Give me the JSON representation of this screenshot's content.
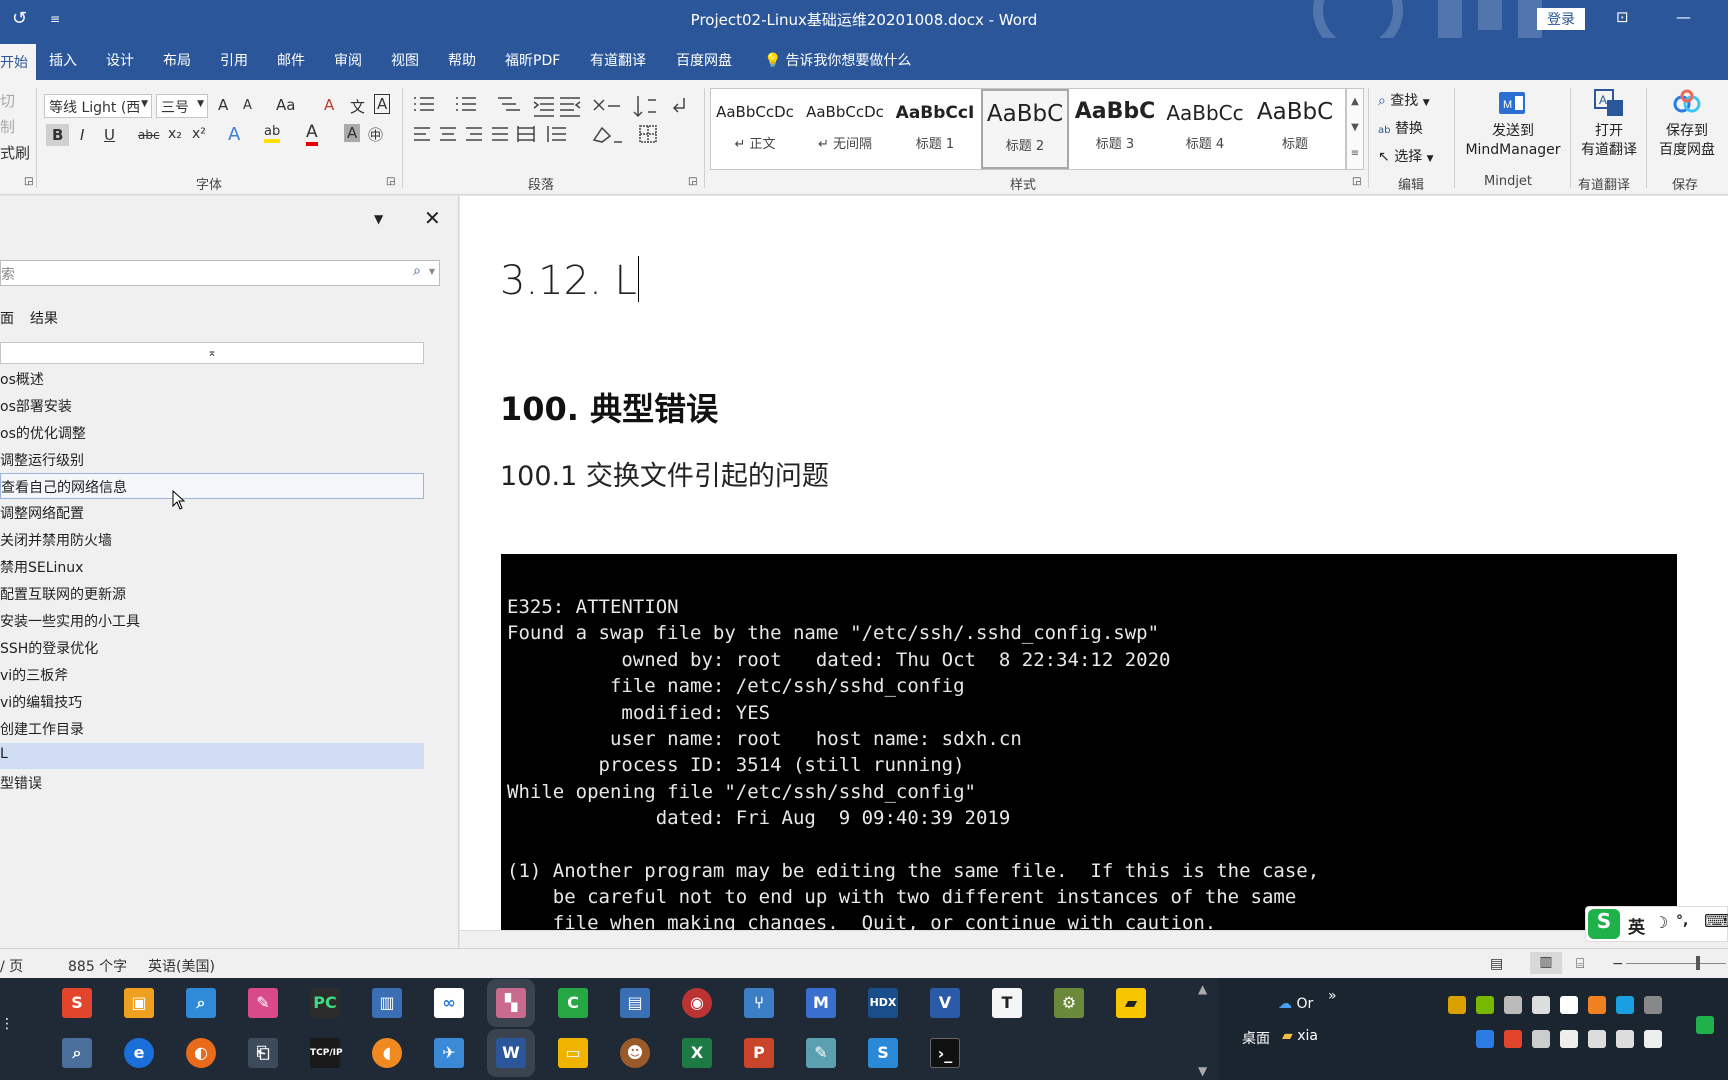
{
  "titlebar": {
    "document_title": "Project02-Linux基础运维20201008.docx  -  Word",
    "login_label": "登录",
    "ribbon_display_icon": "ribbon-display-options-icon",
    "minimize_glyph": "—"
  },
  "tabs": [
    "开始",
    "插入",
    "设计",
    "布局",
    "引用",
    "邮件",
    "审阅",
    "视图",
    "帮助",
    "福昕PDF",
    "有道翻译",
    "百度网盘"
  ],
  "tell_me": "告诉我你想要做什么",
  "clipboard": {
    "cut": "切",
    "copy": "制",
    "painter": "式刷"
  },
  "font": {
    "name": "等线 Light (西",
    "size": "三号",
    "group_label": "字体",
    "bold": "B",
    "italic": "I",
    "underline": "U",
    "strike": "abc",
    "sub": "x₂",
    "sup": "x²",
    "text_effect": "A",
    "highlight": "ab",
    "font_color": "A",
    "shade": "A",
    "enclose": "㊥",
    "grow": "A",
    "shrink": "A",
    "change_case": "Aa",
    "clear": "A",
    "phonetic": "文",
    "border": "A"
  },
  "paragraph": {
    "group_label": "段落"
  },
  "styles": {
    "group_label": "样式",
    "items": [
      {
        "sample": "AaBbCcDc",
        "name": "↵ 正文"
      },
      {
        "sample": "AaBbCcDc",
        "name": "↵ 无间隔"
      },
      {
        "sample": "AaBbCcI",
        "name": "标题 1"
      },
      {
        "sample": "AaBbC",
        "name": "标题 2"
      },
      {
        "sample": "AaBbC",
        "name": "标题 3"
      },
      {
        "sample": "AaBbCc",
        "name": "标题 4"
      },
      {
        "sample": "AaBbC",
        "name": "标题"
      }
    ]
  },
  "editing": {
    "find": "查找",
    "replace": "替换",
    "select": "选择",
    "group_label": "编辑"
  },
  "mindjet": {
    "line1": "发送到",
    "line2": "MindManager",
    "group_label": "Mindjet"
  },
  "youdao": {
    "line1": "打开",
    "line2": "有道翻译",
    "group_label": "有道翻译"
  },
  "baidu": {
    "line1": "保存到",
    "line2": "百度网盘",
    "group_label": "保存"
  },
  "navpane": {
    "search_placeholder": "索",
    "tabs": [
      "面",
      "结果"
    ],
    "collapse_glyph": "⌅",
    "items": [
      "os概述",
      "os部署安装",
      "os的优化调整",
      "调整运行级别",
      "查看自己的网络信息",
      "调整网络配置",
      "关闭并禁用防火墙",
      "禁用SELinux",
      "配置互联网的更新源",
      "安装一些实用的小工具",
      "SSH的登录优化",
      "vi的三板斧",
      " vi的编辑技巧",
      " 创建工作目录",
      " L",
      "型错误"
    ]
  },
  "document": {
    "heading_main": "3.12. L",
    "heading_1": "100.  典型错误",
    "heading_2": "100.1  交换文件引起的问题",
    "terminal_lines": [
      "E325: ATTENTION",
      "Found a swap file by the name \"/etc/ssh/.sshd_config.swp\"",
      "          owned by: root   dated: Thu Oct  8 22:34:12 2020",
      "         file name: /etc/ssh/sshd_config",
      "          modified: YES",
      "         user name: root   host name: sdxh.cn",
      "        process ID: 3514 (still running)",
      "While opening file \"/etc/ssh/sshd_config\"",
      "             dated: Fri Aug  9 09:40:39 2019",
      "",
      "(1) Another program may be editing the same file.  If this is the case,",
      "    be careful not to end up with two different instances of the same",
      "    file when making changes.  Quit, or continue with caution."
    ]
  },
  "statusbar": {
    "page": "/ 页",
    "words": "885 个字",
    "language": "英语(美国)"
  },
  "ime": {
    "lang": "英",
    "moon": "☽",
    "punct": "°,",
    "keyboard": "⌨"
  },
  "taskbar": {
    "tray_onedrive": "Or",
    "tray_desktop": "桌面",
    "tray_folder": "xia",
    "tray_more": "»"
  },
  "colors": {
    "word_blue": "#2b579a",
    "nav_selected": "#cfdcf2",
    "taskbar": "#1f2a36"
  }
}
